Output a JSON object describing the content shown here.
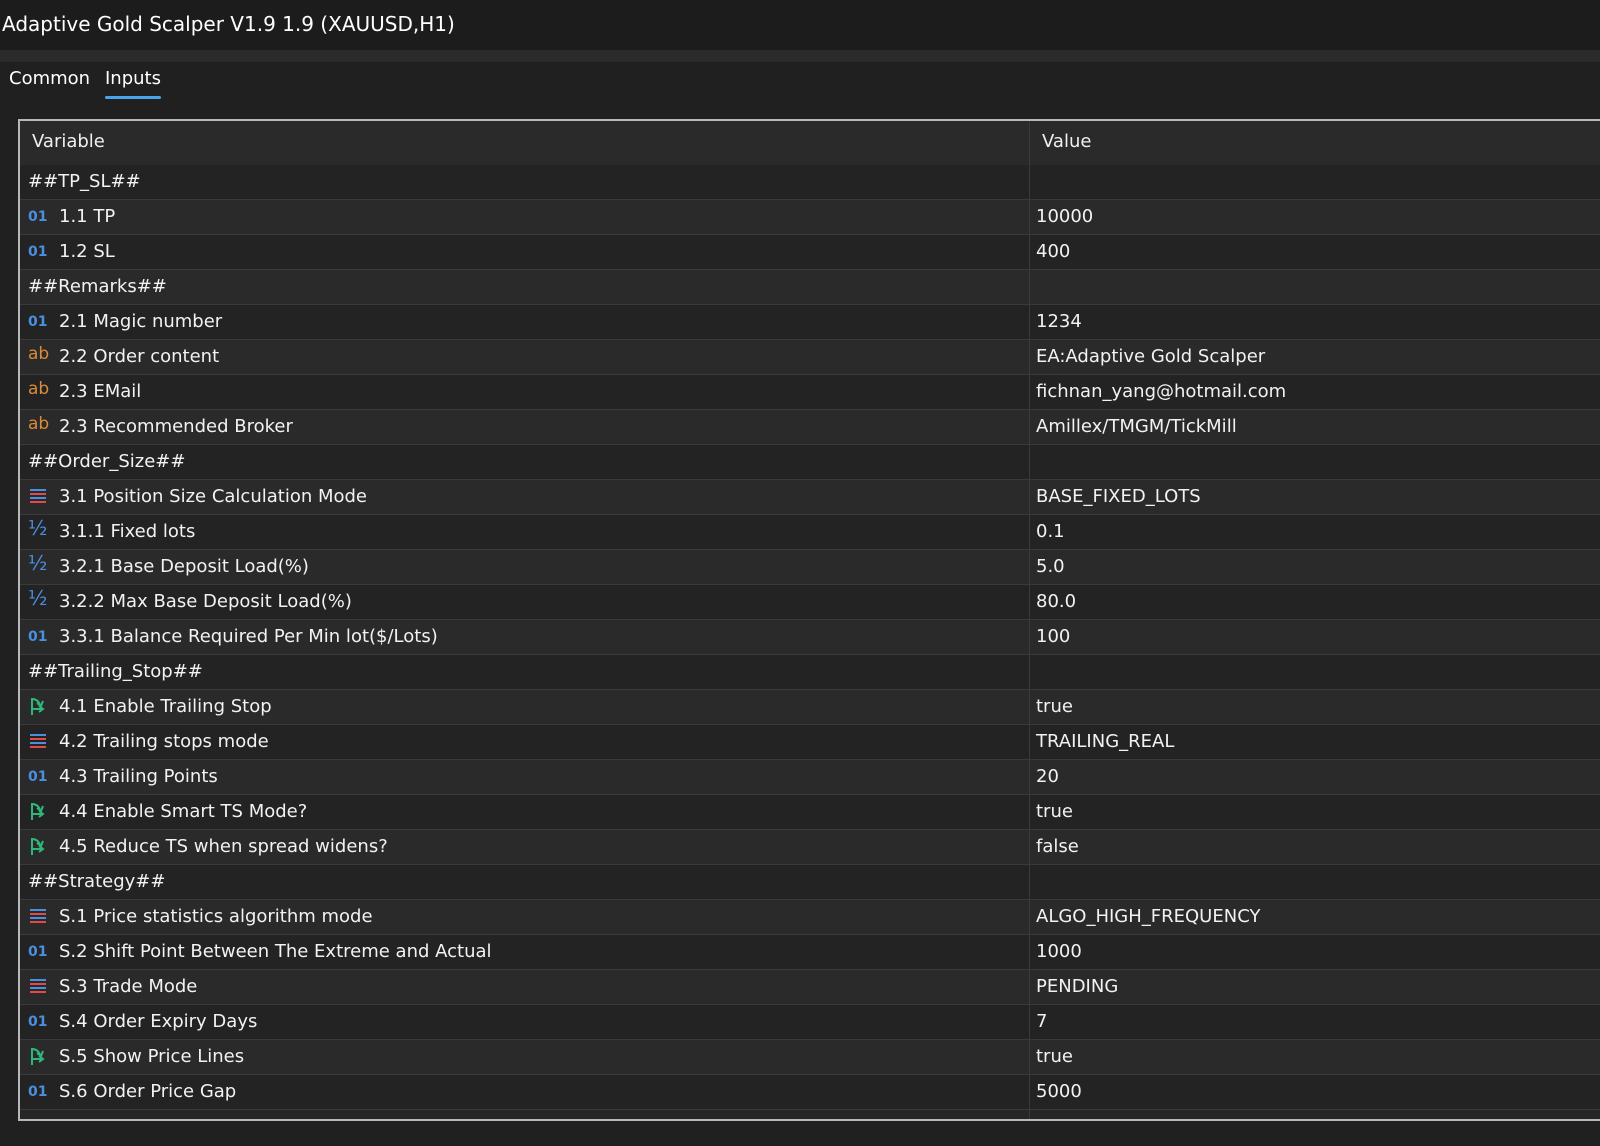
{
  "window": {
    "title": "Adaptive Gold Scalper V1.9 1.9 (XAUUSD,H1)"
  },
  "tabs": [
    {
      "label": "Common",
      "active": false
    },
    {
      "label": "Inputs",
      "active": true
    }
  ],
  "columns": {
    "variable": "Variable",
    "value": "Value"
  },
  "accent_color": "#4aa3e8",
  "rows": [
    {
      "type": "group",
      "name": "##TP_SL##",
      "value": ""
    },
    {
      "type": "int",
      "icon": "int-icon",
      "name": "1.1 TP",
      "value": "10000"
    },
    {
      "type": "int",
      "icon": "int-icon",
      "name": "1.2 SL",
      "value": "400"
    },
    {
      "type": "group",
      "name": "##Remarks##",
      "value": ""
    },
    {
      "type": "int",
      "icon": "int-icon",
      "name": "2.1 Magic number",
      "value": "1234"
    },
    {
      "type": "string",
      "icon": "string-icon",
      "name": "2.2 Order content",
      "value": "EA:Adaptive Gold Scalper"
    },
    {
      "type": "string",
      "icon": "string-icon",
      "name": "2.3 EMail",
      "value": "fichnan_yang@hotmail.com"
    },
    {
      "type": "string",
      "icon": "string-icon",
      "name": "2.3 Recommended Broker",
      "value": "Amillex/TMGM/TickMill"
    },
    {
      "type": "group",
      "name": "##Order_Size##",
      "value": ""
    },
    {
      "type": "enum",
      "icon": "enum-icon",
      "name": "3.1 Position Size Calculation Mode",
      "value": "BASE_FIXED_LOTS"
    },
    {
      "type": "double",
      "icon": "double-icon",
      "name": "3.1.1 Fixed lots",
      "value": "0.1"
    },
    {
      "type": "double",
      "icon": "double-icon",
      "name": "3.2.1 Base Deposit Load(%)",
      "value": "5.0"
    },
    {
      "type": "double",
      "icon": "double-icon",
      "name": "3.2.2 Max Base Deposit Load(%)",
      "value": "80.0"
    },
    {
      "type": "int",
      "icon": "int-icon",
      "name": "3.3.1 Balance Required Per Min lot($/Lots)",
      "value": "100"
    },
    {
      "type": "group",
      "name": "##Trailing_Stop##",
      "value": ""
    },
    {
      "type": "bool",
      "icon": "bool-icon",
      "name": "4.1 Enable Trailing Stop",
      "value": "true"
    },
    {
      "type": "enum",
      "icon": "enum-icon",
      "name": "4.2 Trailing stops mode",
      "value": "TRAILING_REAL"
    },
    {
      "type": "int",
      "icon": "int-icon",
      "name": "4.3 Trailing Points",
      "value": "20"
    },
    {
      "type": "bool",
      "icon": "bool-icon",
      "name": "4.4 Enable Smart TS Mode?",
      "value": "true"
    },
    {
      "type": "bool",
      "icon": "bool-icon",
      "name": "4.5 Reduce TS when spread widens?",
      "value": "false"
    },
    {
      "type": "group",
      "name": "##Strategy##",
      "value": ""
    },
    {
      "type": "enum",
      "icon": "enum-icon",
      "name": "S.1 Price statistics algorithm mode",
      "value": "ALGO_HIGH_FREQUENCY"
    },
    {
      "type": "int",
      "icon": "int-icon",
      "name": "S.2 Shift Point Between The Extreme and Actual",
      "value": "1000"
    },
    {
      "type": "enum",
      "icon": "enum-icon",
      "name": "S.3 Trade Mode",
      "value": "PENDING"
    },
    {
      "type": "int",
      "icon": "int-icon",
      "name": "S.4 Order Expiry Days",
      "value": "7"
    },
    {
      "type": "bool",
      "icon": "bool-icon",
      "name": "S.5 Show Price Lines",
      "value": "true"
    },
    {
      "type": "int",
      "icon": "int-icon",
      "name": "S.6 Order Price Gap",
      "value": "5000"
    }
  ]
}
